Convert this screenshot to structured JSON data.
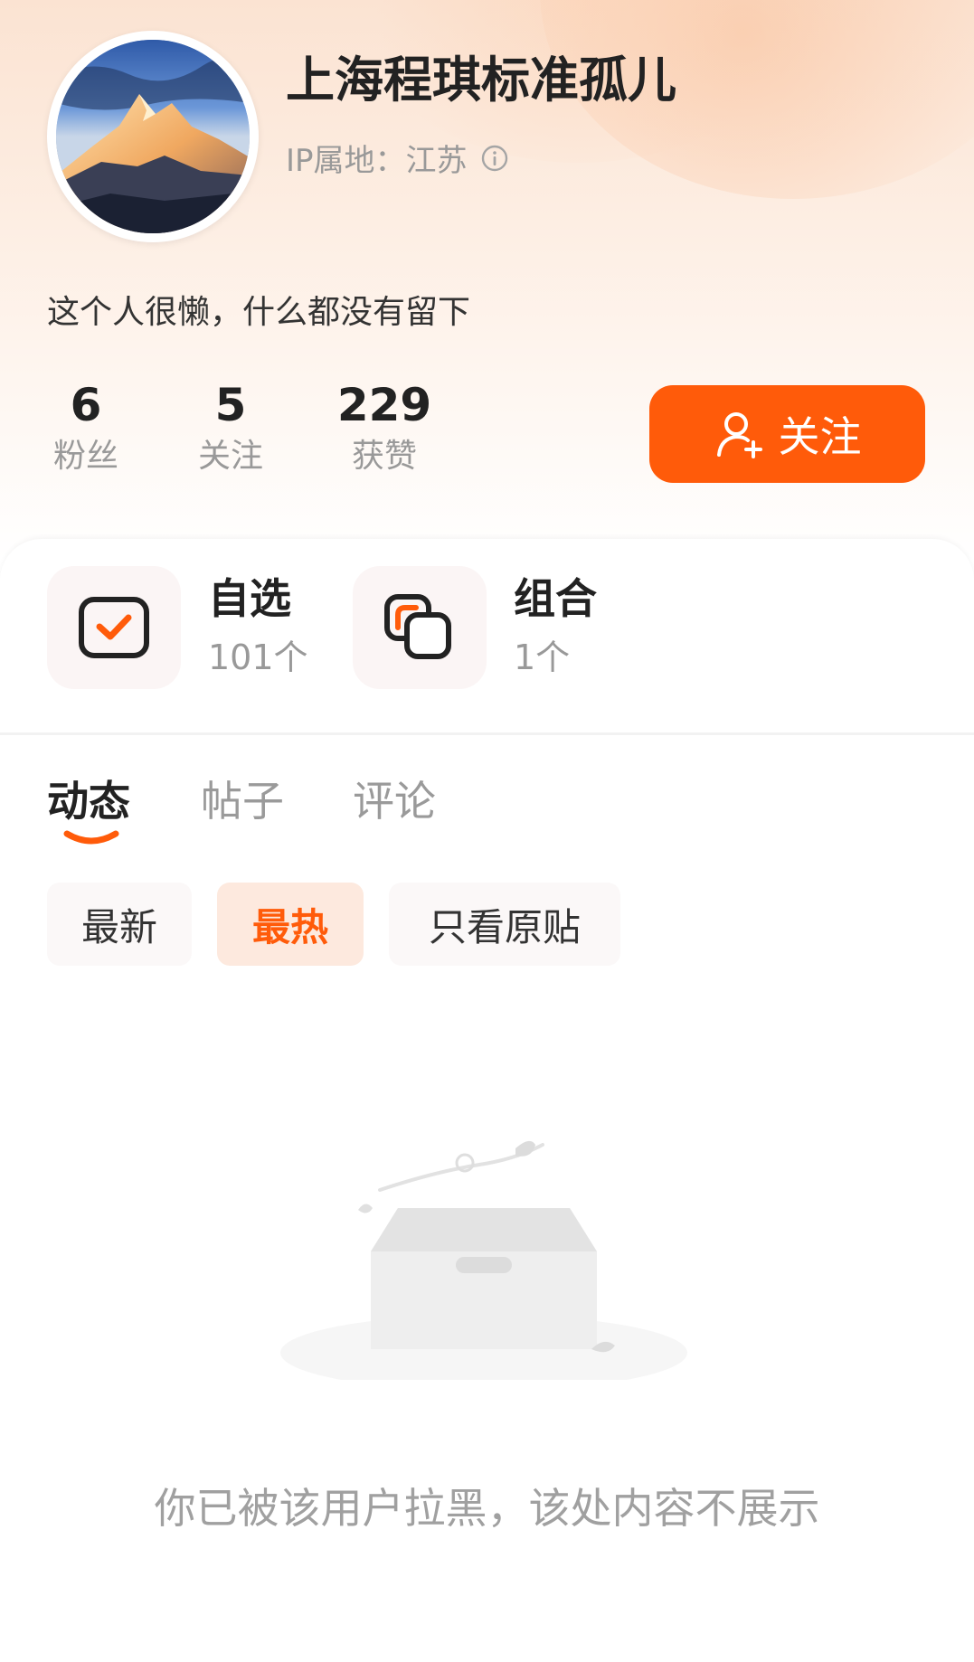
{
  "profile": {
    "username": "上海程琪标准孤儿",
    "ip_location": "IP属地：江苏",
    "bio": "这个人很懒，什么都没有留下"
  },
  "stats": [
    {
      "value": "6",
      "label": "粉丝"
    },
    {
      "value": "5",
      "label": "关注"
    },
    {
      "value": "229",
      "label": "获赞"
    }
  ],
  "follow_button": {
    "label": "关注",
    "icon": "add-user-icon"
  },
  "cards": [
    {
      "title": "自选",
      "count": "101个",
      "icon": "watchlist-check-icon"
    },
    {
      "title": "组合",
      "count": "1个",
      "icon": "portfolio-overlap-icon"
    }
  ],
  "tabs": [
    {
      "label": "动态",
      "active": true
    },
    {
      "label": "帖子",
      "active": false
    },
    {
      "label": "评论",
      "active": false
    }
  ],
  "filters": [
    {
      "label": "最新",
      "active": false
    },
    {
      "label": "最热",
      "active": true
    },
    {
      "label": "只看原贴",
      "active": false
    }
  ],
  "empty_state": {
    "message": "你已被该用户拉黑，该处内容不展示",
    "icon": "empty-box-icon"
  },
  "colors": {
    "accent": "#ff5b0a",
    "accent_light": "#fde9de",
    "text_primary": "#222222",
    "text_secondary": "#999999"
  }
}
